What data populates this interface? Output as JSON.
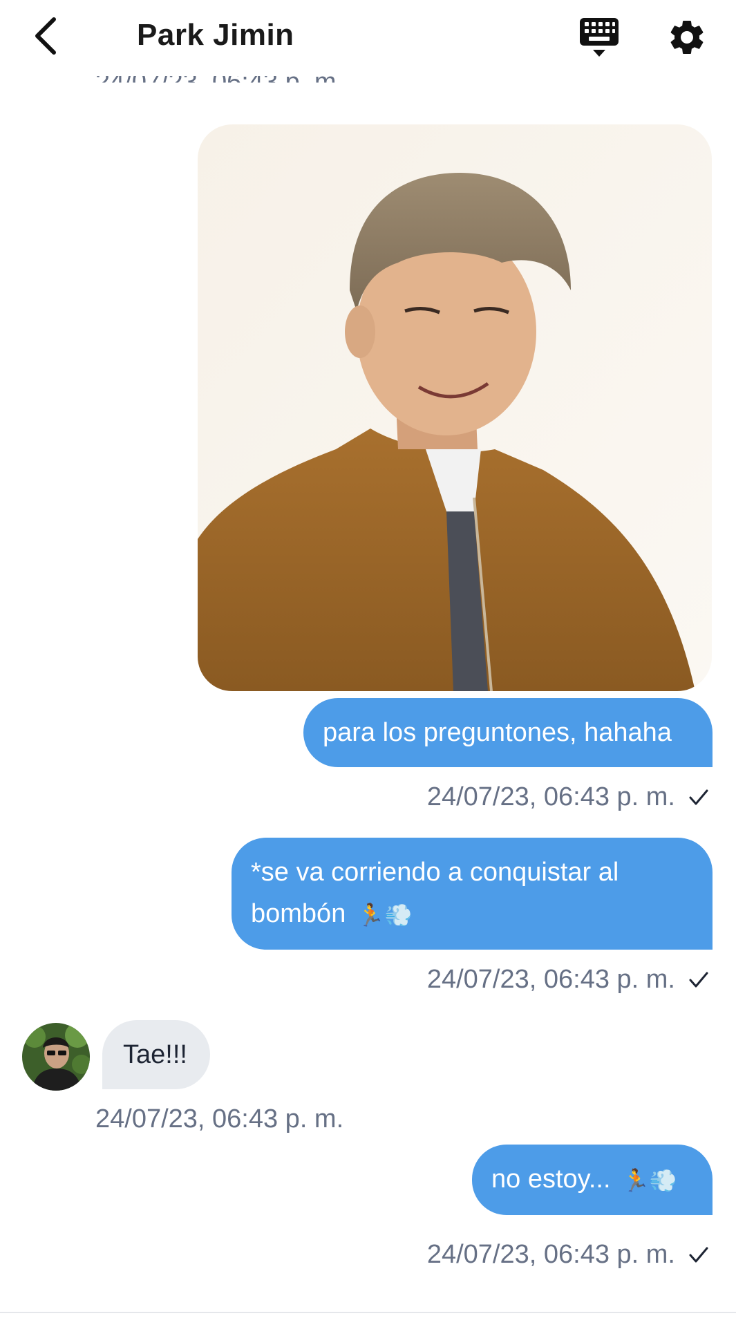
{
  "header": {
    "title": "Park Jimin"
  },
  "messages": {
    "partial_timestamp": "24/07/23, 06:43 p. m.",
    "m1_text": "para los preguntones, hahaha",
    "m1_time": "24/07/23, 06:43 p. m.",
    "m2_line1": "*se va corriendo a conquistar al",
    "m2_line2": "bombón",
    "m2_emoji": "🏃💨",
    "m2_time": "24/07/23, 06:43 p. m.",
    "m3_text": "Tae!!!",
    "m3_time": "24/07/23, 06:43 p. m.",
    "m4_text": "no estoy...",
    "m4_emoji": "🏃💨",
    "m4_time": "24/07/23, 06:43 p. m."
  },
  "icons": {
    "back": "chevron-left-icon",
    "keyboard": "keyboard-icon",
    "settings": "gear-icon",
    "read": "check-icon"
  },
  "colors": {
    "outgoing_bubble": "#4d9ce8",
    "incoming_bubble": "#e8ebef",
    "timestamp": "#667085"
  }
}
